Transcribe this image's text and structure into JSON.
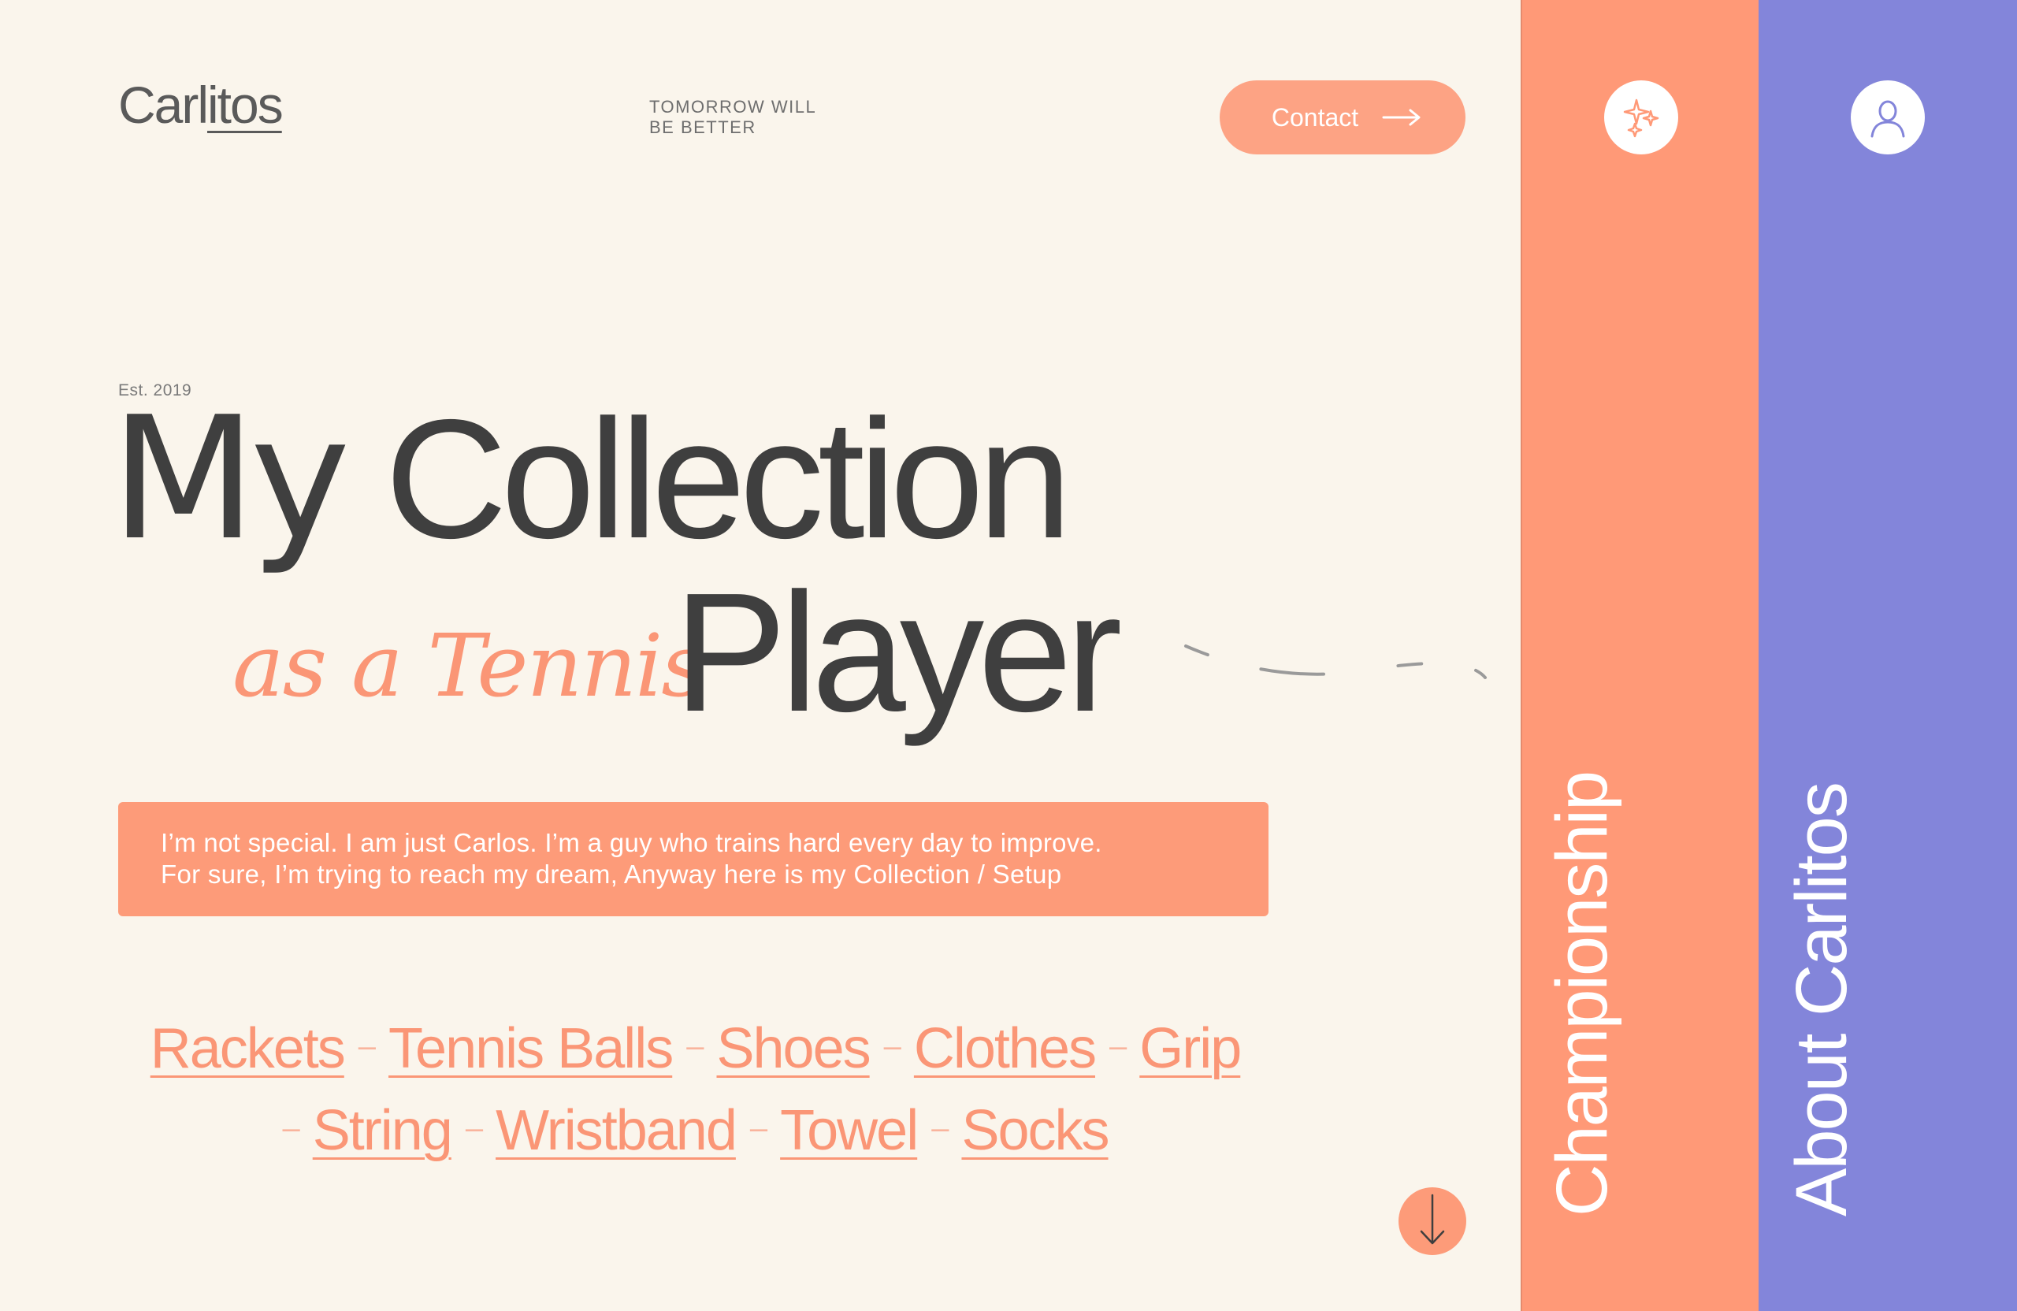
{
  "header": {
    "logo": "Carlitos",
    "logo_prefix": "Carl",
    "logo_underlined": "itos",
    "tagline_line1": "TOMORROW WILL",
    "tagline_line2": "BE BETTER",
    "contact_label": "Contact"
  },
  "hero": {
    "est": "Est. 2019",
    "headline_line1_first": "My",
    "headline_line1_rest": "Collection",
    "script_text": "as a Tennis",
    "headline_line2": "Player",
    "intro_line1": "I’m not special. I am just Carlos. I’m a guy who trains hard every day to improve.",
    "intro_line2": "For sure, I’m trying to reach my dream, Anyway here is my Collection / Setup"
  },
  "categories": {
    "row1": [
      "Rackets",
      "Tennis Balls",
      "Shoes",
      "Clothes",
      "Grip"
    ],
    "row2": [
      "String",
      "Wristband",
      "Towel",
      "Socks"
    ],
    "separator": "–"
  },
  "panels": {
    "championship": {
      "label": "Championship",
      "icon": "sparkles-icon",
      "color": "#FF9977"
    },
    "about": {
      "label": "About Carlitos",
      "icon": "user-icon",
      "color": "#8385DA"
    }
  },
  "colors": {
    "background": "#FAF5EC",
    "accent": "#FD9B79",
    "text_dark": "#3F3F3F"
  }
}
